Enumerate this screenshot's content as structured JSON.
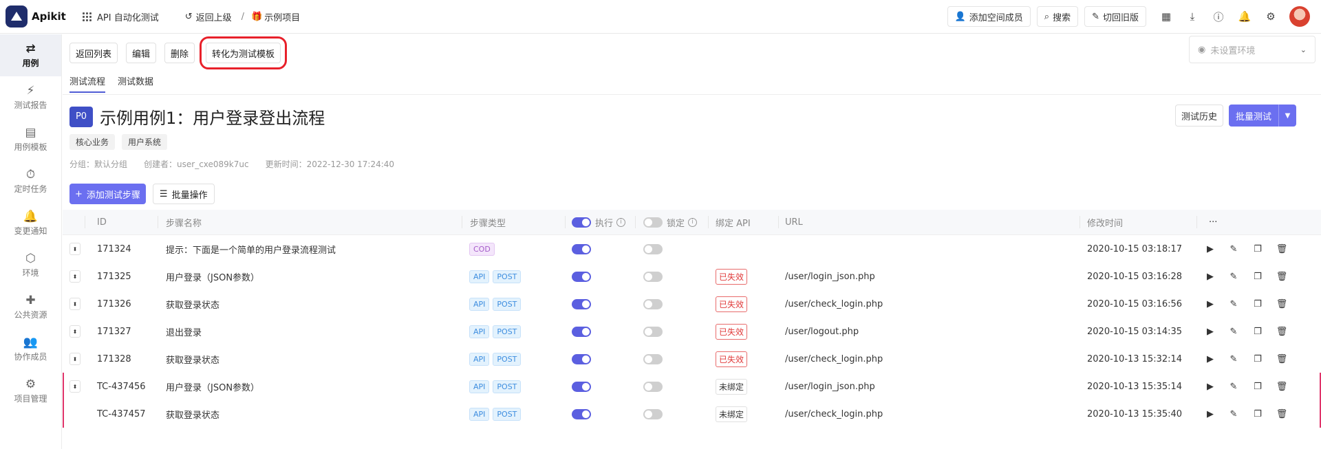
{
  "app": {
    "name": "Apikit"
  },
  "topbar": {
    "workspace": "API 自动化测试",
    "back": "返回上级",
    "separator": "/",
    "project": "示例项目",
    "add_member": "添加空间成员",
    "search": "搜索",
    "old_version": "切回旧版"
  },
  "sidebar": {
    "items": [
      {
        "label": "用例",
        "icon": "swap-icon"
      },
      {
        "label": "测试报告",
        "icon": "report-icon"
      },
      {
        "label": "用例模板",
        "icon": "template-icon"
      },
      {
        "label": "定时任务",
        "icon": "timer-icon"
      },
      {
        "label": "变更通知",
        "icon": "bell-icon"
      },
      {
        "label": "环境",
        "icon": "cube-icon"
      },
      {
        "label": "公共资源",
        "icon": "puzzle-icon"
      },
      {
        "label": "协作成员",
        "icon": "users-icon"
      },
      {
        "label": "项目管理",
        "icon": "gear-icon"
      }
    ]
  },
  "toolbar": {
    "back_list": "返回列表",
    "edit": "编辑",
    "delete": "删除",
    "convert": "转化为测试模板"
  },
  "env": {
    "placeholder": "未设置环境"
  },
  "tabs": {
    "flow": "测试流程",
    "data": "测试数据"
  },
  "case": {
    "priority": "P0",
    "title": "示例用例1：用户登录登出流程",
    "tags": [
      "核心业务",
      "用户系统"
    ],
    "group": "分组：默认分组",
    "creator": "创建者：user_cxe089k7uc",
    "updated": "更新时间：2022-12-30 17:24:40",
    "history": "测试历史",
    "batch_test": "批量测试"
  },
  "actions": {
    "add_step": "添加测试步骤",
    "batch_ops": "批量操作"
  },
  "table": {
    "headers": {
      "id": "ID",
      "name": "步骤名称",
      "type": "步骤类型",
      "execute": "执行",
      "lock": "锁定",
      "bind_api": "绑定 API",
      "url": "URL",
      "modified": "修改时间",
      "more": "···"
    },
    "rows": [
      {
        "id": "171324",
        "name": "提示：下面是一个简单的用户登录流程测试",
        "types": [
          "COD"
        ],
        "execute": true,
        "lock": false,
        "bind": "",
        "url": "",
        "modified": "2020-10-15 03:18:17",
        "drag": true,
        "flag": false
      },
      {
        "id": "171325",
        "name": "用户登录（JSON参数）",
        "types": [
          "API",
          "POST"
        ],
        "execute": true,
        "lock": false,
        "bind": "已失效",
        "url": "/user/login_json.php",
        "modified": "2020-10-15 03:16:28",
        "drag": true,
        "flag": false
      },
      {
        "id": "171326",
        "name": "获取登录状态",
        "types": [
          "API",
          "POST"
        ],
        "execute": true,
        "lock": false,
        "bind": "已失效",
        "url": "/user/check_login.php",
        "modified": "2020-10-15 03:16:56",
        "drag": true,
        "flag": false
      },
      {
        "id": "171327",
        "name": "退出登录",
        "types": [
          "API",
          "POST"
        ],
        "execute": true,
        "lock": false,
        "bind": "已失效",
        "url": "/user/logout.php",
        "modified": "2020-10-15 03:14:35",
        "drag": true,
        "flag": false
      },
      {
        "id": "171328",
        "name": "获取登录状态",
        "types": [
          "API",
          "POST"
        ],
        "execute": true,
        "lock": false,
        "bind": "已失效",
        "url": "/user/check_login.php",
        "modified": "2020-10-13 15:32:14",
        "drag": true,
        "flag": false
      },
      {
        "id": "TC-437456",
        "name": "用户登录（JSON参数）",
        "types": [
          "API",
          "POST"
        ],
        "execute": true,
        "lock": false,
        "bind": "未绑定",
        "url": "/user/login_json.php",
        "modified": "2020-10-13 15:35:14",
        "drag": true,
        "flag": true
      },
      {
        "id": "TC-437457",
        "name": "获取登录状态",
        "types": [
          "API",
          "POST"
        ],
        "execute": true,
        "lock": false,
        "bind": "未绑定",
        "url": "/user/check_login.php",
        "modified": "2020-10-13 15:35:40",
        "drag": false,
        "flag": true
      }
    ]
  },
  "colors": {
    "accent": "#6b6ff0",
    "highlight": "#e8202a",
    "invalid": "#e03a3a"
  }
}
